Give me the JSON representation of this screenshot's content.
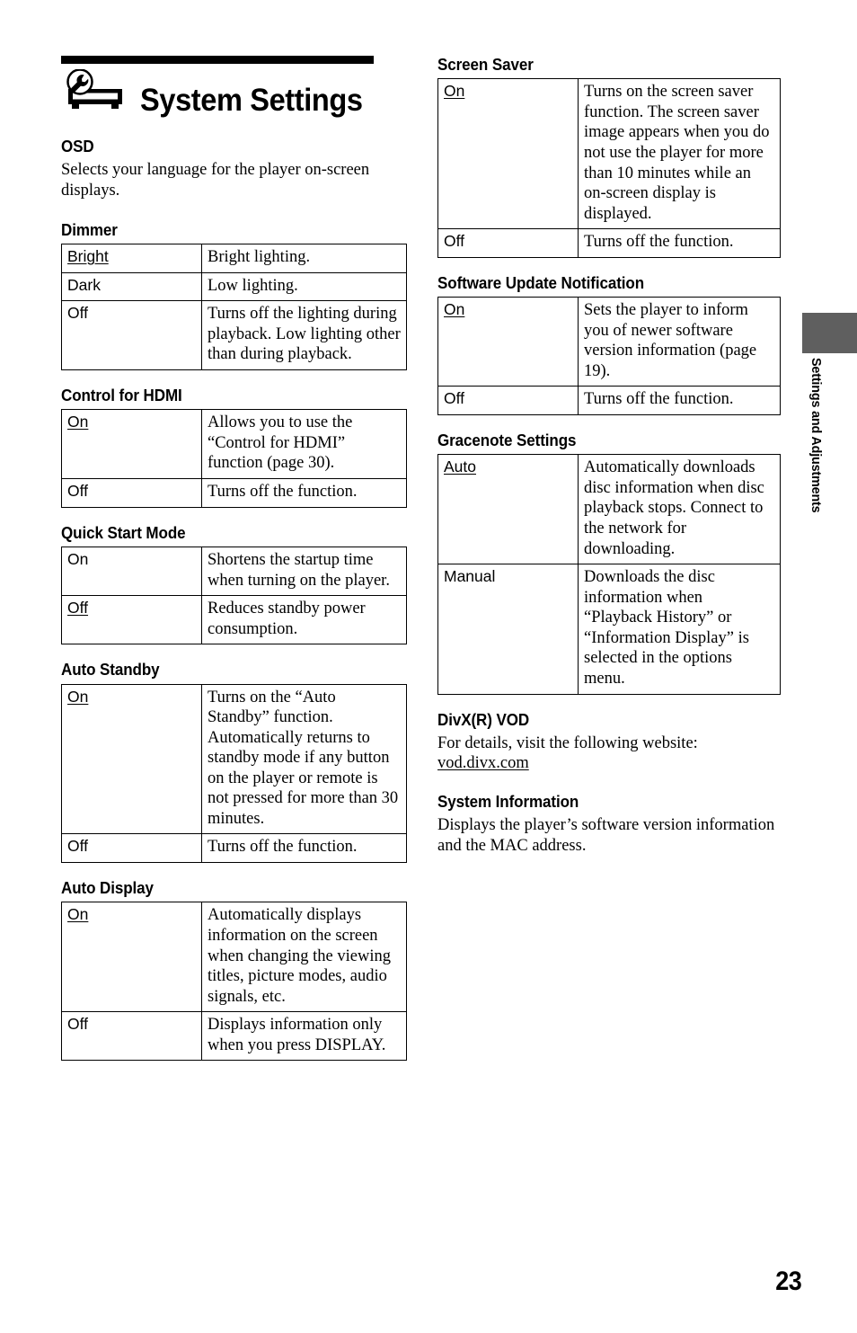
{
  "page": {
    "number": "23",
    "side_tab_label": "Settings and Adjustments",
    "title": "System Settings",
    "title_icon": "player-with-wrench-icon"
  },
  "left_column": {
    "osd": {
      "heading": "OSD",
      "body": "Selects your language for the player on-screen displays."
    },
    "dimmer": {
      "heading": "Dimmer",
      "rows": [
        {
          "key": "Bright",
          "underlined": true,
          "value": "Bright lighting."
        },
        {
          "key": "Dark",
          "underlined": false,
          "value": "Low lighting."
        },
        {
          "key": "Off",
          "underlined": false,
          "value": "Turns off the lighting during playback. Low lighting other than during playback."
        }
      ]
    },
    "control_for_hdmi": {
      "heading": "Control for HDMI",
      "rows": [
        {
          "key": "On",
          "underlined": true,
          "value": "Allows you to use the “Control for HDMI” function (page 30)."
        },
        {
          "key": "Off",
          "underlined": false,
          "value": "Turns off the function."
        }
      ]
    },
    "quick_start_mode": {
      "heading": "Quick Start Mode",
      "rows": [
        {
          "key": "On",
          "underlined": false,
          "value": "Shortens the startup time when turning on the player."
        },
        {
          "key": "Off",
          "underlined": true,
          "value": "Reduces standby power consumption."
        }
      ]
    },
    "auto_standby": {
      "heading": "Auto Standby",
      "rows": [
        {
          "key": "On",
          "underlined": true,
          "value": "Turns on the “Auto Standby” function. Automatically returns to standby mode if any button on the player or remote is not pressed for more than 30 minutes."
        },
        {
          "key": "Off",
          "underlined": false,
          "value": "Turns off the function."
        }
      ]
    },
    "auto_display": {
      "heading": "Auto Display",
      "rows": [
        {
          "key": "On",
          "underlined": true,
          "value": "Automatically displays information on the screen when changing the viewing titles, picture modes, audio signals, etc."
        },
        {
          "key": "Off",
          "underlined": false,
          "value": "Displays information only when you press DISPLAY."
        }
      ]
    }
  },
  "right_column": {
    "screen_saver": {
      "heading": "Screen Saver",
      "rows": [
        {
          "key": "On",
          "underlined": true,
          "value": "Turns on the screen saver function. The screen saver image appears when you do not use the player for more than 10 minutes while an on-screen display is displayed."
        },
        {
          "key": "Off",
          "underlined": false,
          "value": "Turns off the function."
        }
      ]
    },
    "software_update_notification": {
      "heading": "Software Update Notification",
      "rows": [
        {
          "key": "On",
          "underlined": true,
          "value": "Sets the player to inform you of newer software version information (page 19)."
        },
        {
          "key": "Off",
          "underlined": false,
          "value": "Turns off the function."
        }
      ]
    },
    "gracenote_settings": {
      "heading": "Gracenote Settings",
      "rows": [
        {
          "key": "Auto",
          "underlined": true,
          "value": "Automatically downloads disc information when disc playback stops. Connect to the network for downloading."
        },
        {
          "key": "Manual",
          "underlined": false,
          "value": "Downloads the disc information when “Playback History” or “Information Display” is selected in the options menu."
        }
      ]
    },
    "divx_vod": {
      "heading": "DivX(R) VOD",
      "body": "For details, visit the following website:",
      "url": "vod.divx.com"
    },
    "system_information": {
      "heading": "System Information",
      "body": "Displays the player’s software version information and the MAC address."
    }
  }
}
